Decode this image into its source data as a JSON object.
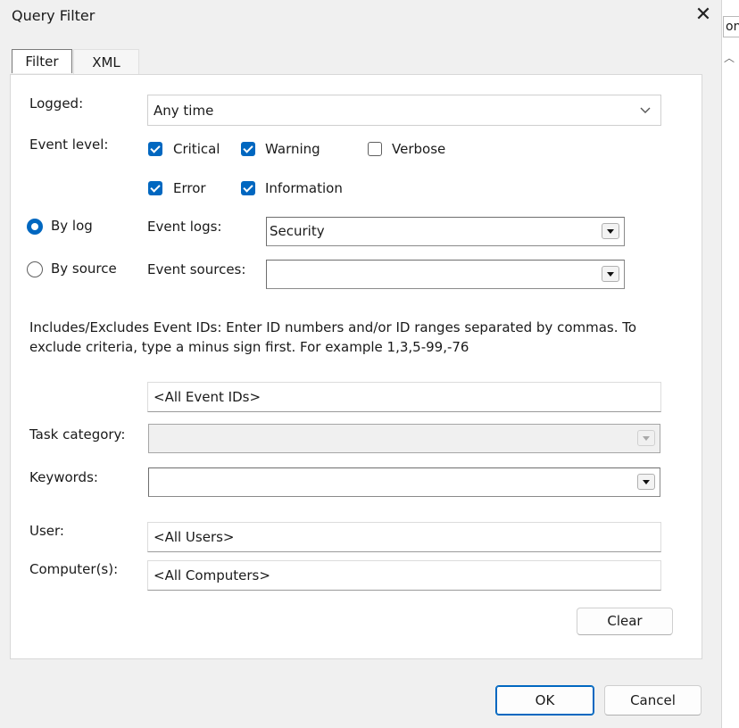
{
  "window": {
    "title": "Query Filter"
  },
  "background_window": {
    "strip_text": "on"
  },
  "tabs": [
    {
      "label": "Filter",
      "active": true
    },
    {
      "label": "XML",
      "active": false
    }
  ],
  "logged": {
    "label": "Logged:",
    "value": "Any time"
  },
  "event_level": {
    "label": "Event level:",
    "options": [
      {
        "label": "Critical",
        "checked": true
      },
      {
        "label": "Warning",
        "checked": true
      },
      {
        "label": "Verbose",
        "checked": false
      },
      {
        "label": "Error",
        "checked": true
      },
      {
        "label": "Information",
        "checked": true
      }
    ]
  },
  "source_mode": {
    "by_log": {
      "label": "By log",
      "selected": true
    },
    "by_source": {
      "label": "By source",
      "selected": false
    }
  },
  "event_logs": {
    "label": "Event logs:",
    "value": "Security"
  },
  "event_sources": {
    "label": "Event sources:",
    "value": ""
  },
  "event_ids": {
    "help_line1": "Includes/Excludes Event IDs: Enter ID numbers and/or ID ranges separated by commas. To",
    "help_line2": "exclude criteria, type a minus sign first. For example 1,3,5-99,-76",
    "value": "<All Event IDs>"
  },
  "task_category": {
    "label": "Task category:",
    "value": ""
  },
  "keywords": {
    "label": "Keywords:",
    "value": ""
  },
  "user": {
    "label": "User:",
    "value": "<All Users>"
  },
  "computers": {
    "label": "Computer(s):",
    "value": "<All Computers>"
  },
  "buttons": {
    "clear": "Clear",
    "ok": "OK",
    "cancel": "Cancel"
  },
  "colors": {
    "accent": "#0067c0",
    "panel": "#ffffff",
    "chrome": "#f0f0f0"
  }
}
